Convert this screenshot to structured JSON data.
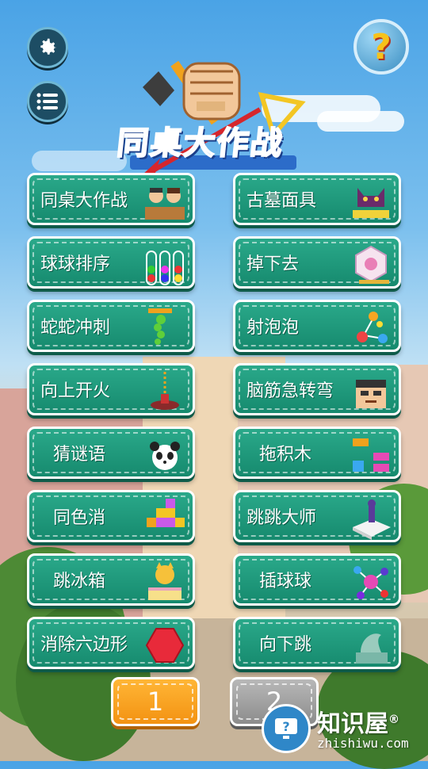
{
  "logo": {
    "title": "同桌大作战"
  },
  "games": [
    {
      "label": "同桌大作战",
      "icon": "desk-mates-icon"
    },
    {
      "label": "古墓面具",
      "icon": "cat-mask-icon"
    },
    {
      "label": "球球排序",
      "icon": "ball-tubes-icon"
    },
    {
      "label": "掉下去",
      "icon": "falling-hexagon-icon"
    },
    {
      "label": "蛇蛇冲刺",
      "icon": "snake-icon"
    },
    {
      "label": "射泡泡",
      "icon": "bubbles-icon"
    },
    {
      "label": "向上开火",
      "icon": "cannon-icon"
    },
    {
      "label": "脑筋急转弯",
      "icon": "puzzled-face-icon"
    },
    {
      "label": "猜谜语",
      "icon": "panda-icon"
    },
    {
      "label": "拖积木",
      "icon": "blocks-icon"
    },
    {
      "label": "同色消",
      "icon": "star-blocks-icon"
    },
    {
      "label": "跳跳大师",
      "icon": "jump-platform-icon"
    },
    {
      "label": "跳冰箱",
      "icon": "cat-box-icon"
    },
    {
      "label": "插球球",
      "icon": "molecule-icon"
    },
    {
      "label": "消除六边形",
      "icon": "red-hexagon-icon"
    },
    {
      "label": "向下跳",
      "icon": "dragon-statue-icon"
    }
  ],
  "pagination": {
    "page1": "1",
    "page2": "2",
    "current": 1
  },
  "help": {
    "symbol": "?"
  },
  "watermark": {
    "title": "知识屋",
    "registered": "®",
    "url": "zhishiwu.com"
  },
  "colors": {
    "card": "#1f9a7c",
    "active_page": "#f7a21f",
    "inactive_page": "#9e9e9e"
  }
}
